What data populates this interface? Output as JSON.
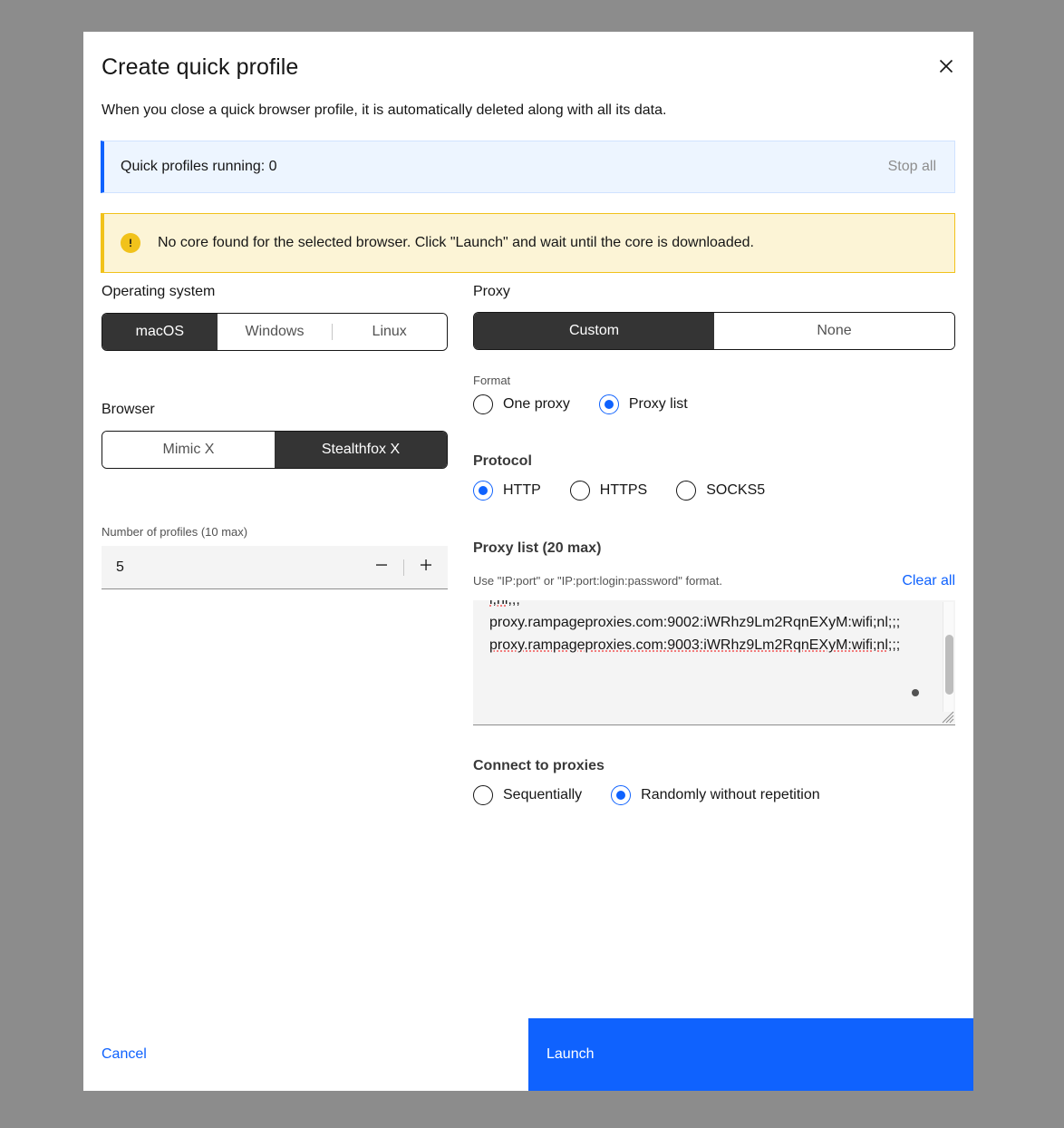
{
  "modal": {
    "title": "Create quick profile",
    "subtitle": "When you close a quick browser profile, it is automatically deleted along with all its data.",
    "close_icon": "close-icon"
  },
  "info_banner": {
    "text": "Quick profiles running: 0",
    "action_label": "Stop all",
    "accent_color": "#0f62fe",
    "background_color": "#edf5ff"
  },
  "warning_banner": {
    "icon": "warning-filled-icon",
    "text": "No core found for the selected browser. Click \"Launch\" and wait until the core is downloaded.",
    "accent_color": "#f1c21b",
    "background_color": "#fcf4d6"
  },
  "operating_system": {
    "label": "Operating system",
    "options": [
      "macOS",
      "Windows",
      "Linux"
    ],
    "selected": "macOS"
  },
  "browser": {
    "label": "Browser",
    "options": [
      "Mimic X",
      "Stealthfox X"
    ],
    "selected": "Stealthfox X"
  },
  "number_of_profiles": {
    "label": "Number of profiles (10 max)",
    "value": "5",
    "decrement_icon": "minus-icon",
    "increment_icon": "plus-icon"
  },
  "proxy": {
    "label": "Proxy",
    "options": [
      "Custom",
      "None"
    ],
    "selected": "Custom"
  },
  "format": {
    "label": "Format",
    "options": [
      "One proxy",
      "Proxy list"
    ],
    "selected": "Proxy list"
  },
  "protocol": {
    "label": "Protocol",
    "options": [
      "HTTP",
      "HTTPS",
      "SOCKS5"
    ],
    "selected": "HTTP"
  },
  "proxy_list": {
    "label": "Proxy list (20 max)",
    "hint": "Use \"IP:port\" or \"IP:port:login:password\" format.",
    "clear_label": "Clear all",
    "lines": [
      "i;nl;;;",
      "proxy.rampageproxies.com:9002:iWRhz9Lm2RqnEXyM:wifi;nl;;;",
      "proxy.rampageproxies.com:9003:iWRhz9Lm2RqnEXyM:wifi;nl;;;"
    ]
  },
  "connect_to_proxies": {
    "label": "Connect to proxies",
    "options": [
      "Sequentially",
      "Randomly without repetition"
    ],
    "selected": "Randomly without repetition"
  },
  "footer": {
    "cancel_label": "Cancel",
    "launch_label": "Launch",
    "launch_color": "#0f62fe"
  }
}
